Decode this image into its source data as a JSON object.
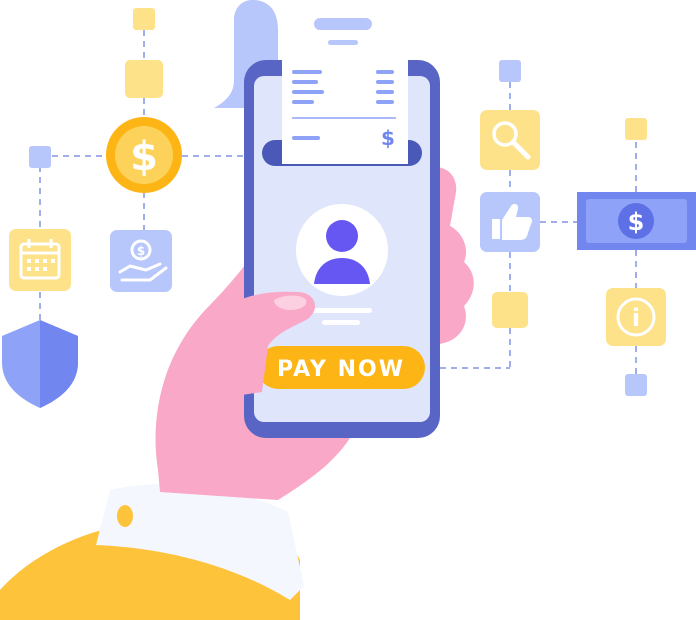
{
  "phone": {
    "pay_button_label": "PAY NOW"
  },
  "receipt": {
    "currency_symbol": "$"
  },
  "icons": {
    "coin_symbol": "$",
    "bill_symbol": "$",
    "hand_coin_symbol": "$",
    "info_symbol": "i"
  },
  "colors": {
    "accent_yellow": "#fdb515",
    "icon_tile_yellow": "#fde28a",
    "icon_tile_blue": "#b7c6fb",
    "phone_frame": "#5865c4",
    "screen_bg": "#dfe6fb",
    "avatar": "#6657f2",
    "hand": "#f9a9c7",
    "sleeve": "#fdc33a",
    "connector_line": "#8293e6"
  }
}
